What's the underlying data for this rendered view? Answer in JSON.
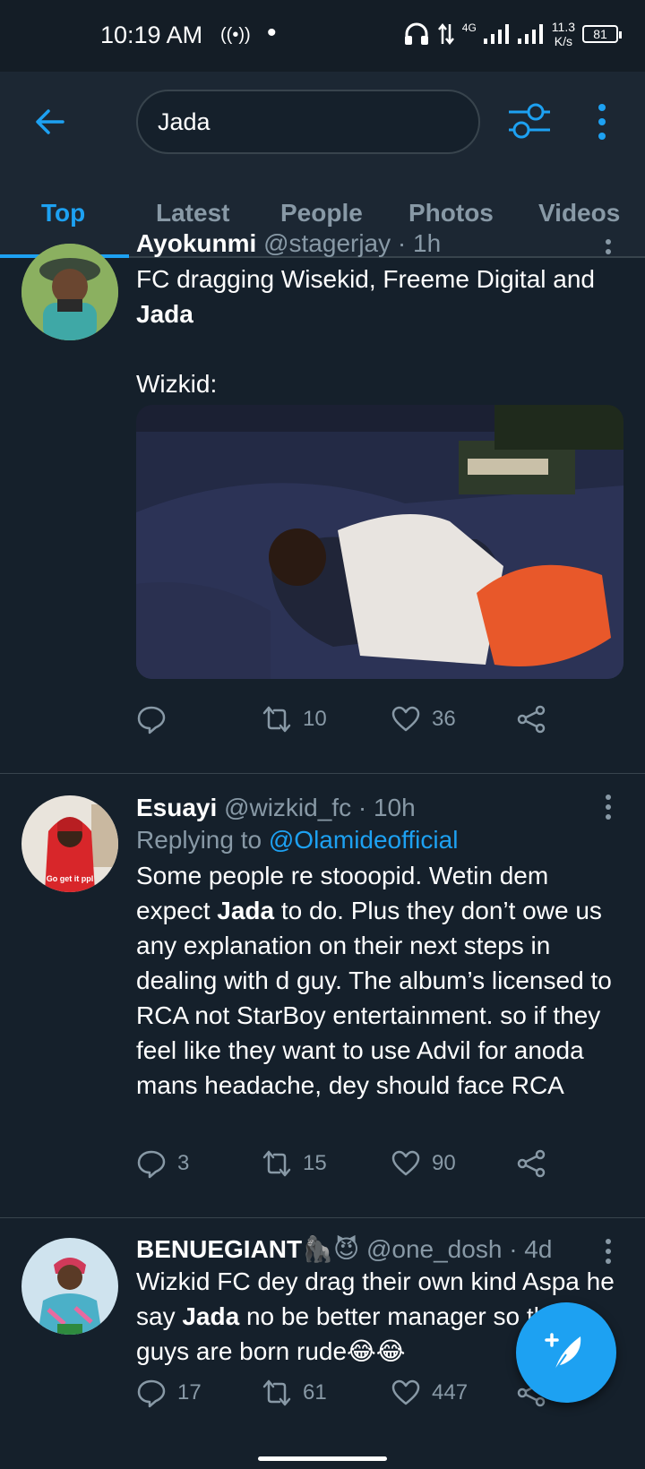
{
  "status": {
    "time": "10:19 AM",
    "network": "4G",
    "speed_value": "11.3",
    "speed_unit": "K/s",
    "battery": "81"
  },
  "search": {
    "query": "Jada"
  },
  "tabs": [
    {
      "label": "Top",
      "active": true
    },
    {
      "label": "Latest"
    },
    {
      "label": "People"
    },
    {
      "label": "Photos"
    },
    {
      "label": "Videos"
    }
  ],
  "tweets": [
    {
      "name": "Ayokunmi",
      "handle": "@stagerjay",
      "time": "· 1h",
      "text_1": "FC dragging Wisekid, Freeme Digital and",
      "text_bold": "Jada",
      "text_2": "Wizkid:",
      "replies": "",
      "retweets": "10",
      "likes": "36"
    },
    {
      "name": "Esuayi",
      "handle": "@wizkid_fc",
      "time": "· 10h",
      "replying_prefix": "Replying to",
      "replying_to": "@Olamideofficial",
      "text_pre": "Some people re stooopid. Wetin dem expect",
      "text_bold": "Jada",
      "text_post": "to do. Plus they don’t owe us any explanation on their next steps in dealing with d guy. The album’s licensed to RCA not StarBoy entertainment. so if they feel like they want to use Advil for anoda mans headache, dey should face RCA",
      "avatar_caption": "Go get it ppl",
      "replies": "3",
      "retweets": "15",
      "likes": "90"
    },
    {
      "name": "BENUEGIANT",
      "name_emojis": "🦍😈",
      "handle": "@one_dosh",
      "time": "· 4d",
      "text_pre": "Wizkid FC dey drag their own kind Aspa he say",
      "text_bold": "Jada",
      "text_post": "no be better manager so these guys are born rude😂😂",
      "replies": "17",
      "retweets": "61",
      "likes": "447"
    }
  ],
  "colors": {
    "background": "#15202b",
    "bar": "#1c2733",
    "accent": "#1da1f2",
    "muted": "#8899a6",
    "divider": "#38444d"
  }
}
